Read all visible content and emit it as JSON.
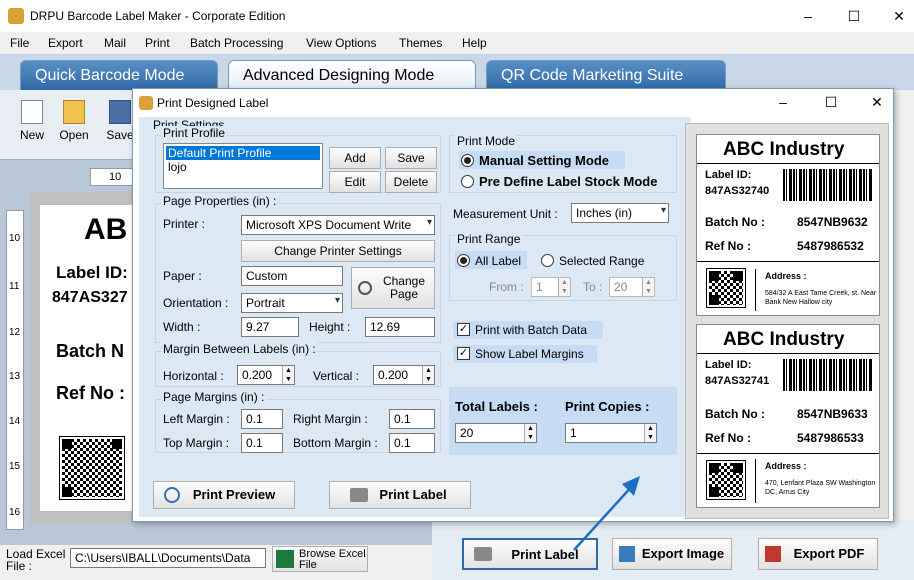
{
  "app": {
    "title": "DRPU Barcode Label Maker - Corporate Edition",
    "menu": [
      "File",
      "Export",
      "Mail",
      "Print",
      "Batch Processing",
      "View Options",
      "Themes",
      "Help"
    ],
    "mode_tabs": [
      "Quick Barcode Mode",
      "Advanced Designing Mode",
      "QR Code Marketing Suite"
    ],
    "toolbar": [
      "New",
      "Open",
      "Save"
    ],
    "window_controls": [
      "–",
      "☐",
      "✕"
    ]
  },
  "background": {
    "ruler_h": "10",
    "ruler_v": [
      "10",
      "11",
      "12",
      "13",
      "14",
      "15",
      "16"
    ],
    "label": {
      "company": "AB",
      "label_id": "Label ID:",
      "label_id_value": "847AS327",
      "batch": "Batch N",
      "ref": "Ref No :"
    },
    "status": {
      "load_excel": "Load Excel File :",
      "path": "C:\\Users\\IBALL\\Documents\\Data",
      "browse": "Browse Excel File"
    },
    "bottom_buttons": {
      "print_label": "Print Label",
      "export_image": "Export Image",
      "export_pdf": "Export PDF"
    }
  },
  "dialog": {
    "title": "Print Designed Label",
    "window_controls": [
      "–",
      "☐",
      "✕"
    ],
    "print_settings": "Print Settings",
    "print_profile": {
      "legend": "Print Profile",
      "items": [
        "Default Print Profile",
        "lojo"
      ],
      "add": "Add",
      "save": "Save",
      "edit": "Edit",
      "delete": "Delete"
    },
    "page_properties": {
      "legend": "Page Properties (in) :",
      "printer_label": "Printer :",
      "printer_value": "Microsoft XPS Document Write",
      "change_printer": "Change Printer Settings",
      "paper_label": "Paper :",
      "paper_value": "Custom",
      "orientation_label": "Orientation :",
      "orientation_value": "Portrait",
      "change_page": "Change Page",
      "width_label": "Width :",
      "width_value": "9.27",
      "height_label": "Height :",
      "height_value": "12.69"
    },
    "margin_between": {
      "legend": "Margin Between Labels (in) :",
      "horizontal_label": "Horizontal :",
      "horizontal_value": "0.200",
      "vertical_label": "Vertical :",
      "vertical_value": "0.200"
    },
    "page_margins": {
      "legend": "Page Margins (in) :",
      "left_label": "Left Margin :",
      "left_value": "0.1",
      "right_label": "Right Margin :",
      "right_value": "0.1",
      "top_label": "Top Margin :",
      "top_value": "0.1",
      "bottom_label": "Bottom Margin :",
      "bottom_value": "0.1"
    },
    "print_mode": {
      "legend": "Print Mode",
      "manual": "Manual Setting Mode",
      "predefine": "Pre Define Label Stock Mode",
      "selected": "manual"
    },
    "measurement_label": "Measurement Unit :",
    "measurement_value": "Inches (in)",
    "print_range": {
      "legend": "Print Range",
      "all": "All Label",
      "selected_range": "Selected Range",
      "from_label": "From :",
      "from_value": "1",
      "to_label": "To :",
      "to_value": "20"
    },
    "print_batch": "Print with Batch Data",
    "show_margins": "Show Label Margins",
    "total_labels_label": "Total Labels :",
    "total_labels_value": "20",
    "print_copies_label": "Print Copies :",
    "print_copies_value": "1",
    "print_preview": "Print Preview",
    "print_label": "Print Label"
  },
  "preview_labels": [
    {
      "company": "ABC Industry",
      "label_id": "Label ID:",
      "label_id_value": "847AS32740",
      "batch_label": "Batch No :",
      "batch_value": "8547NB9632",
      "ref_label": "Ref No :",
      "ref_value": "5487986532",
      "address_label": "Address :",
      "address": "584/32 A East Tame Creek, st. Near Bank New Hallow city"
    },
    {
      "company": "ABC Industry",
      "label_id": "Label ID:",
      "label_id_value": "847AS32741",
      "batch_label": "Batch No :",
      "batch_value": "8547NB9633",
      "ref_label": "Ref No :",
      "ref_value": "5487986533",
      "address_label": "Address :",
      "address": "470, Lenfant Plaza SW Washington DC, Arrus City"
    }
  ]
}
